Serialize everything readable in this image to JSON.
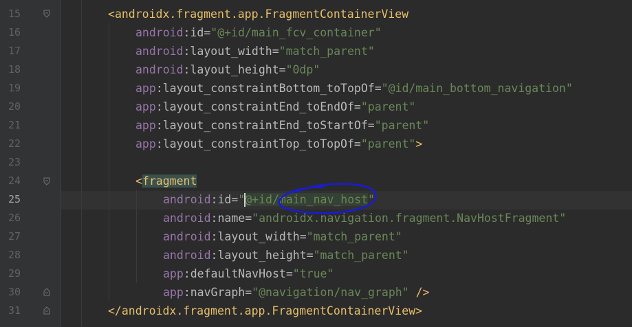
{
  "editor": {
    "line_numbers": [
      "15",
      "16",
      "17",
      "18",
      "19",
      "20",
      "21",
      "22",
      "23",
      "24",
      "25",
      "26",
      "27",
      "28",
      "29",
      "30",
      "31"
    ],
    "current_line": "25",
    "lines": {
      "l15": {
        "open": "<",
        "tag": "androidx.fragment.app.FragmentContainerView"
      },
      "l16": {
        "ns": "android",
        "colon": ":",
        "attr": "id",
        "eq": "=",
        "val": "\"@+id/main_fcv_container\""
      },
      "l17": {
        "ns": "android",
        "colon": ":",
        "attr": "layout_width",
        "eq": "=",
        "val": "\"match_parent\""
      },
      "l18": {
        "ns": "android",
        "colon": ":",
        "attr": "layout_height",
        "eq": "=",
        "val": "\"0dp\""
      },
      "l19": {
        "ns": "app",
        "colon": ":",
        "attr": "layout_constraintBottom_toTopOf",
        "eq": "=",
        "val": "\"@id/main_bottom_navigation\""
      },
      "l20": {
        "ns": "app",
        "colon": ":",
        "attr": "layout_constraintEnd_toEndOf",
        "eq": "=",
        "val": "\"parent\""
      },
      "l21": {
        "ns": "app",
        "colon": ":",
        "attr": "layout_constraintEnd_toStartOf",
        "eq": "=",
        "val": "\"parent\""
      },
      "l22": {
        "ns": "app",
        "colon": ":",
        "attr": "layout_constraintTop_toTopOf",
        "eq": "=",
        "val": "\"parent\"",
        "close": ">"
      },
      "l24": {
        "open": "<",
        "tag": "fragment"
      },
      "l25": {
        "ns": "android",
        "colon": ":",
        "attr": "id",
        "eq": "=",
        "quote_open": "\"",
        "val_hl": "@+id/main_nav_host",
        "quote_close": "\""
      },
      "l26": {
        "ns": "android",
        "colon": ":",
        "attr": "name",
        "eq": "=",
        "val": "\"androidx.navigation.fragment.NavHostFragment\""
      },
      "l27": {
        "ns": "android",
        "colon": ":",
        "attr": "layout_width",
        "eq": "=",
        "val": "\"match_parent\""
      },
      "l28": {
        "ns": "android",
        "colon": ":",
        "attr": "layout_height",
        "eq": "=",
        "val": "\"match_parent\""
      },
      "l29": {
        "ns": "app",
        "colon": ":",
        "attr": "defaultNavHost",
        "eq": "=",
        "val": "\"true\""
      },
      "l30": {
        "ns": "app",
        "colon": ":",
        "attr": "navGraph",
        "eq": "=",
        "val": "\"@navigation/nav_graph\"",
        "close": " />"
      },
      "l31": {
        "open": "</",
        "tag": "androidx.fragment.app.FragmentContainerView",
        "close": ">"
      }
    }
  },
  "colors": {
    "background": "#2b2b2b",
    "gutter": "#313335",
    "tag": "#e8bf6a",
    "namespace": "#9876aa",
    "attribute": "#bababa",
    "string": "#6a8759",
    "annotation": "#1a1adb"
  }
}
